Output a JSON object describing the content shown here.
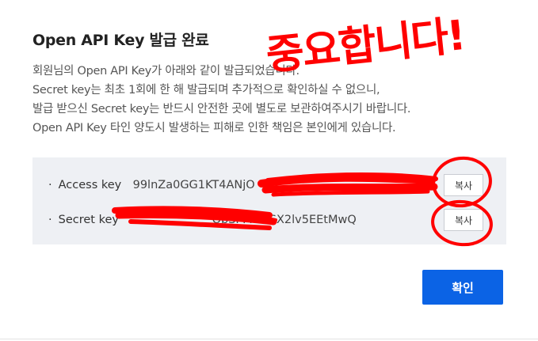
{
  "dialog": {
    "title": "Open API Key 발급 완료",
    "description": [
      "회원님의 Open API Key가 아래와 같이 발급되었습니다.",
      "Secret key는 최초 1회에 한 해 발급되며 추가적으로 확인하실 수 없으니,",
      "발급 받으신 Secret key는 반드시 안전한 곳에 별도로 보관하여주시기 바랍니다.",
      "Open API Key 타인 양도시 발생하는 피해로 인한 책임은 본인에게 있습니다."
    ],
    "keys": {
      "bullet": "·",
      "access_label": "Access key",
      "access_value": "99lnZa0GG1KT4ANjO",
      "secret_label": "Secret key",
      "secret_value_visible": "ObSPMw1SX2lv5EEtMwQ",
      "copy_label": "복사"
    },
    "confirm_label": "확인"
  },
  "annotation": {
    "text": "중요합니다!",
    "color": "#ff0000"
  },
  "colors": {
    "primary": "#0b63e5",
    "key_box_bg": "#eef0f4",
    "redaction": "#ff0000"
  }
}
